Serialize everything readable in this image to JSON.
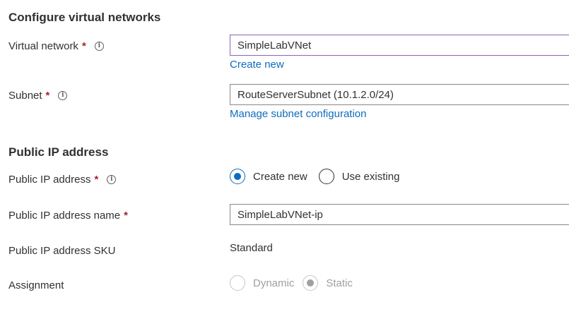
{
  "sections": {
    "vnet_title": "Configure virtual networks",
    "public_ip_title": "Public IP address"
  },
  "virtual_network": {
    "label": "Virtual network",
    "required": "*",
    "info_icon": "info-icon",
    "value": "SimpleLabVNet",
    "create_new_link": "Create new"
  },
  "subnet": {
    "label": "Subnet",
    "required": "*",
    "info_icon": "info-icon",
    "value": "RouteServerSubnet (10.1.2.0/24)",
    "manage_link": "Manage subnet configuration"
  },
  "public_ip": {
    "label": "Public IP address",
    "required": "*",
    "info_icon": "info-icon",
    "options": [
      {
        "label": "Create new",
        "checked": true
      },
      {
        "label": "Use existing",
        "checked": false
      }
    ]
  },
  "public_ip_name": {
    "label": "Public IP address name",
    "required": "*",
    "value": "SimpleLabVNet-ip"
  },
  "public_ip_sku": {
    "label": "Public IP address SKU",
    "value": "Standard"
  },
  "assignment": {
    "label": "Assignment",
    "options": [
      {
        "label": "Dynamic",
        "checked": false,
        "disabled": true
      },
      {
        "label": "Static",
        "checked": true,
        "disabled": true
      }
    ]
  },
  "colors": {
    "accent": "#0f6cbd",
    "required": "#a4262c",
    "focus_border": "#8764b8"
  }
}
